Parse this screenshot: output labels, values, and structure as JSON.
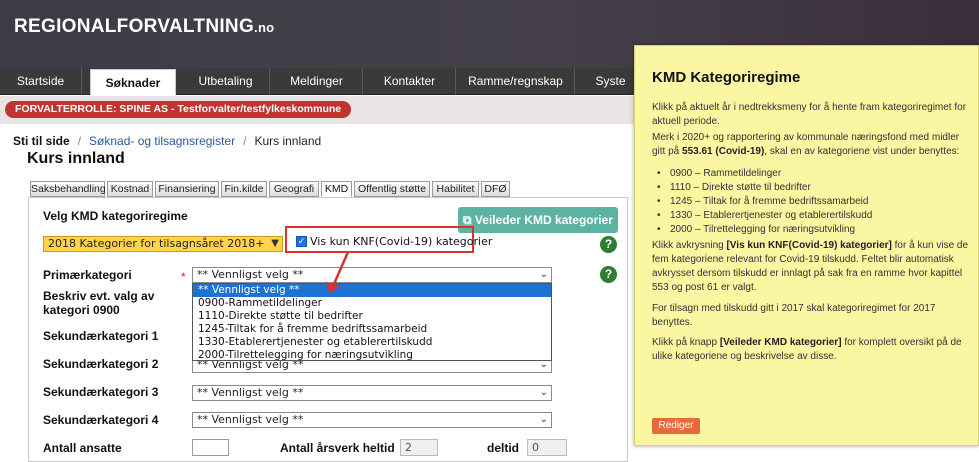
{
  "header": {
    "logo_main": "REGIONALFORVALTNING",
    "logo_suffix": ".no"
  },
  "nav": {
    "tabs": [
      "Startside",
      "Søknader",
      "Utbetaling",
      "Meldinger",
      "Kontakter",
      "Ramme/regnskap",
      "Syste"
    ],
    "active": "Søknader"
  },
  "role": {
    "label": "FORVALTERROLLE: SPINE AS - Testforvalter/testfylkeskommune"
  },
  "breadcrumb": {
    "home": "Sti til side",
    "sep1": "/",
    "link": "Søknad- og tilsagnsregister",
    "sep2": "/",
    "current": "Kurs innland"
  },
  "page": {
    "title": "Kurs innland"
  },
  "subtabs": [
    "Saksbehandling",
    "Kostnad",
    "Finansiering",
    "Fin.kilde",
    "Geografi",
    "KMD",
    "Offentlig støtte",
    "Habilitet",
    "DFØ"
  ],
  "subtab_active": "KMD",
  "form": {
    "regime_label": "Velg KMD kategoriregime",
    "regime_value": "2018 Kategorier for tilsagnsåret 2018+",
    "veileder_button": "Veileder KMD kategorier",
    "knf_checkbox_label": "Vis kun KNF(Covid-19) kategorier",
    "knf_checked": true,
    "primary_label": "Primærkategori",
    "required_mark": "*",
    "primary_value": "** Vennligst velg **",
    "beskriv_label_1": "Beskriv evt. valg av",
    "beskriv_label_2": "kategori 0900",
    "sek1_label": "Sekundærkategori 1",
    "sek2_label": "Sekundærkategori 2",
    "sek3_label": "Sekundærkategori 3",
    "sek4_label": "Sekundærkategori 4",
    "sek_value": "** Vennligst velg **",
    "ansatte_label": "Antall ansatte",
    "ansatte_value": "",
    "aarsverk_label": "Antall årsverk heltid",
    "aarsverk_value": "2",
    "deltid_label": "deltid",
    "deltid_value": "0",
    "help_icon": "?"
  },
  "dropdown": {
    "options": [
      "** Vennligst velg **",
      "0900-Rammetildelinger",
      "1110-Direkte støtte til bedrifter",
      "1245-Tiltak for å fremme bedriftssamarbeid",
      "1330-Etablerertjenester og etablerertilskudd",
      "2000-Tilrettelegging for næringsutvikling"
    ],
    "selected_index": 0
  },
  "popup": {
    "title": "KMD Kategoriregime",
    "p1": "Klikk på aktuelt år i nedtrekksmeny for å hente fram kategoriregimet for aktuell periode.",
    "p2_a": "Merk i 2020+ og rapportering av kommunale næringsfond med midler gitt på ",
    "p2_b": "553.61 (Covid-19)",
    "p2_c": ", skal en av kategoriene vist under benyttes:",
    "list": [
      "0900 – Rammetildelinger",
      "1110 – Direkte støtte til bedrifter",
      "1245 – Tiltak for å fremme bedriftssamarbeid",
      "1330 – Etablerertjenester og etablerertilskudd",
      "2000 – Tilrettelegging for næringsutvikling"
    ],
    "p3_a": "Klikk avkrysning ",
    "p3_b": "[Vis kun KNF(Covid-19) kategorier]",
    "p3_c": " for å kun vise de fem kategoriene relevant for Covid-19 tilskudd. Feltet blir automatisk avkrysset dersom tilskudd er innlagt på sak fra en ramme hvor kapittel 553 og post 61 er valgt.",
    "p4": "For tilsagn med tilskudd gitt i 2017 skal kategoriregimet for 2017 benyttes.",
    "p5_a": "Klikk på knapp ",
    "p5_b": "[Veileder KMD kategorier]",
    "p5_c": " for komplett oversikt på de ulike kategoriene og beskrivelse av disse.",
    "edit_button": "Rediger"
  },
  "colors": {
    "header_bg": "#3c3c46",
    "role_pill": "#c0342f",
    "regime_select": "#ffd44a",
    "veileder_button": "#5cb3a1",
    "popup_bg": "#fbf6a2",
    "highlight_red": "#d7322e",
    "rediger": "#e8693a"
  }
}
